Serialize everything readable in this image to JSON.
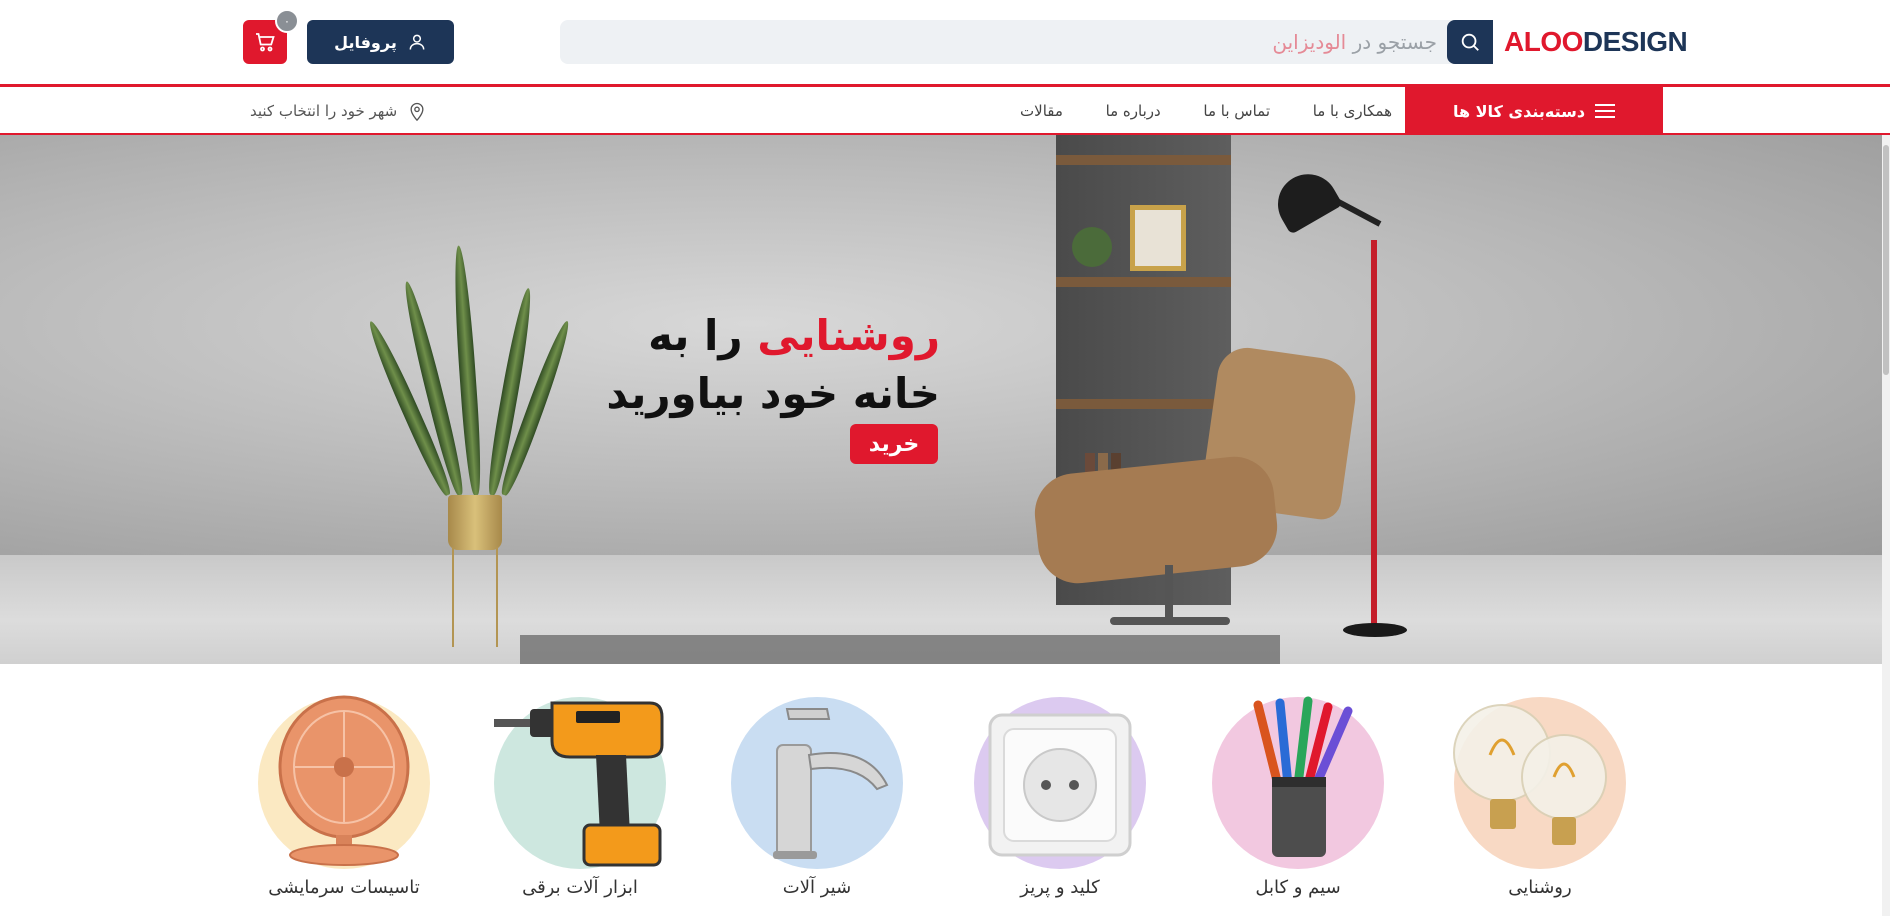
{
  "header": {
    "logo_part1": "ALOO",
    "logo_part2": "DESIGN",
    "search_prefix": "جستجو در",
    "search_brand": "الودیزاین",
    "profile_label": "پروفایل",
    "cart_count": "۰"
  },
  "nav": {
    "categories_label": "دسته‌بندی کالا ها",
    "links": [
      {
        "label": "همکاری با ما"
      },
      {
        "label": "تماس با ما"
      },
      {
        "label": "درباره ما"
      },
      {
        "label": "مقالات"
      }
    ],
    "city_label": "شهر خود را انتخاب کنید"
  },
  "hero": {
    "line1_accent": "روشنایی",
    "line1_rest": "را به",
    "line2": "خانه خود بیاورید",
    "buy_label": "خرید"
  },
  "categories": [
    {
      "label": "روشنایی",
      "icon": "light-bulb-icon",
      "bg": "#f8d9c4"
    },
    {
      "label": "سیم و کابل",
      "icon": "cable-icon",
      "bg": "#f2c8e0"
    },
    {
      "label": "کلید و پریز",
      "icon": "socket-icon",
      "bg": "#dccaf0"
    },
    {
      "label": "شیر آلات",
      "icon": "faucet-icon",
      "bg": "#c9ddf2"
    },
    {
      "label": "ابزار آلات برقی",
      "icon": "drill-icon",
      "bg": "#cde7df"
    },
    {
      "label": "تاسیسات سرمایشی",
      "icon": "fan-icon",
      "bg": "#fbe9c2"
    }
  ],
  "colors": {
    "brand_red": "#e0182d",
    "brand_navy": "#1d3557"
  }
}
